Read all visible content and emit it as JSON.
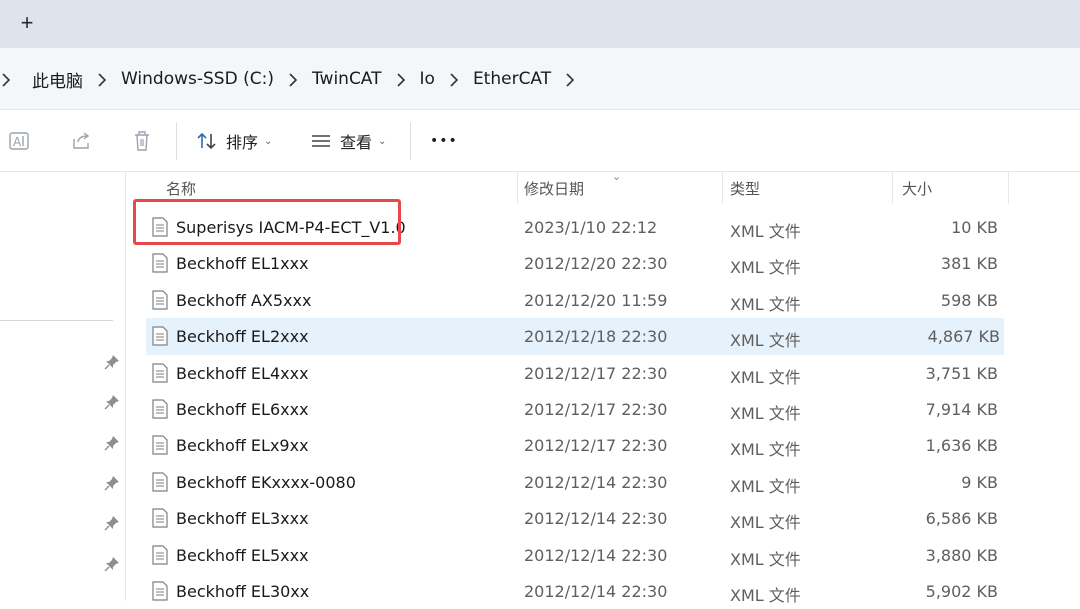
{
  "tabbar": {
    "new_tab_icon": "plus-icon"
  },
  "breadcrumb": [
    "此电脑",
    "Windows-SSD (C:)",
    "TwinCAT",
    "Io",
    "EtherCAT"
  ],
  "toolbar": {
    "sort_label": "排序",
    "view_label": "查看",
    "more_label": "•••"
  },
  "columns": {
    "name": "名称",
    "date": "修改日期",
    "type": "类型",
    "size": "大小"
  },
  "files": [
    {
      "name": "Superisys IACM-P4-ECT_V1.0",
      "date": "2023/1/10 22:12",
      "type": "XML 文件",
      "size": "10 KB"
    },
    {
      "name": "Beckhoff EL1xxx",
      "date": "2012/12/20 22:30",
      "type": "XML 文件",
      "size": "381 KB"
    },
    {
      "name": "Beckhoff AX5xxx",
      "date": "2012/12/20 11:59",
      "type": "XML 文件",
      "size": "598 KB"
    },
    {
      "name": "Beckhoff EL2xxx",
      "date": "2012/12/18 22:30",
      "type": "XML 文件",
      "size": "4,867 KB"
    },
    {
      "name": "Beckhoff EL4xxx",
      "date": "2012/12/17 22:30",
      "type": "XML 文件",
      "size": "3,751 KB"
    },
    {
      "name": "Beckhoff EL6xxx",
      "date": "2012/12/17 22:30",
      "type": "XML 文件",
      "size": "7,914 KB"
    },
    {
      "name": "Beckhoff ELx9xx",
      "date": "2012/12/17 22:30",
      "type": "XML 文件",
      "size": "1,636 KB"
    },
    {
      "name": "Beckhoff EKxxxx-0080",
      "date": "2012/12/14 22:30",
      "type": "XML 文件",
      "size": "9 KB"
    },
    {
      "name": "Beckhoff EL3xxx",
      "date": "2012/12/14 22:30",
      "type": "XML 文件",
      "size": "6,586 KB"
    },
    {
      "name": "Beckhoff EL5xxx",
      "date": "2012/12/14 22:30",
      "type": "XML 文件",
      "size": "3,880 KB"
    },
    {
      "name": "Beckhoff EL30xx",
      "date": "2012/12/14 22:30",
      "type": "XML 文件",
      "size": "5,902 KB"
    }
  ],
  "colors": {
    "highlight": "#e8474b",
    "selected_row": "#e5f1fb"
  }
}
